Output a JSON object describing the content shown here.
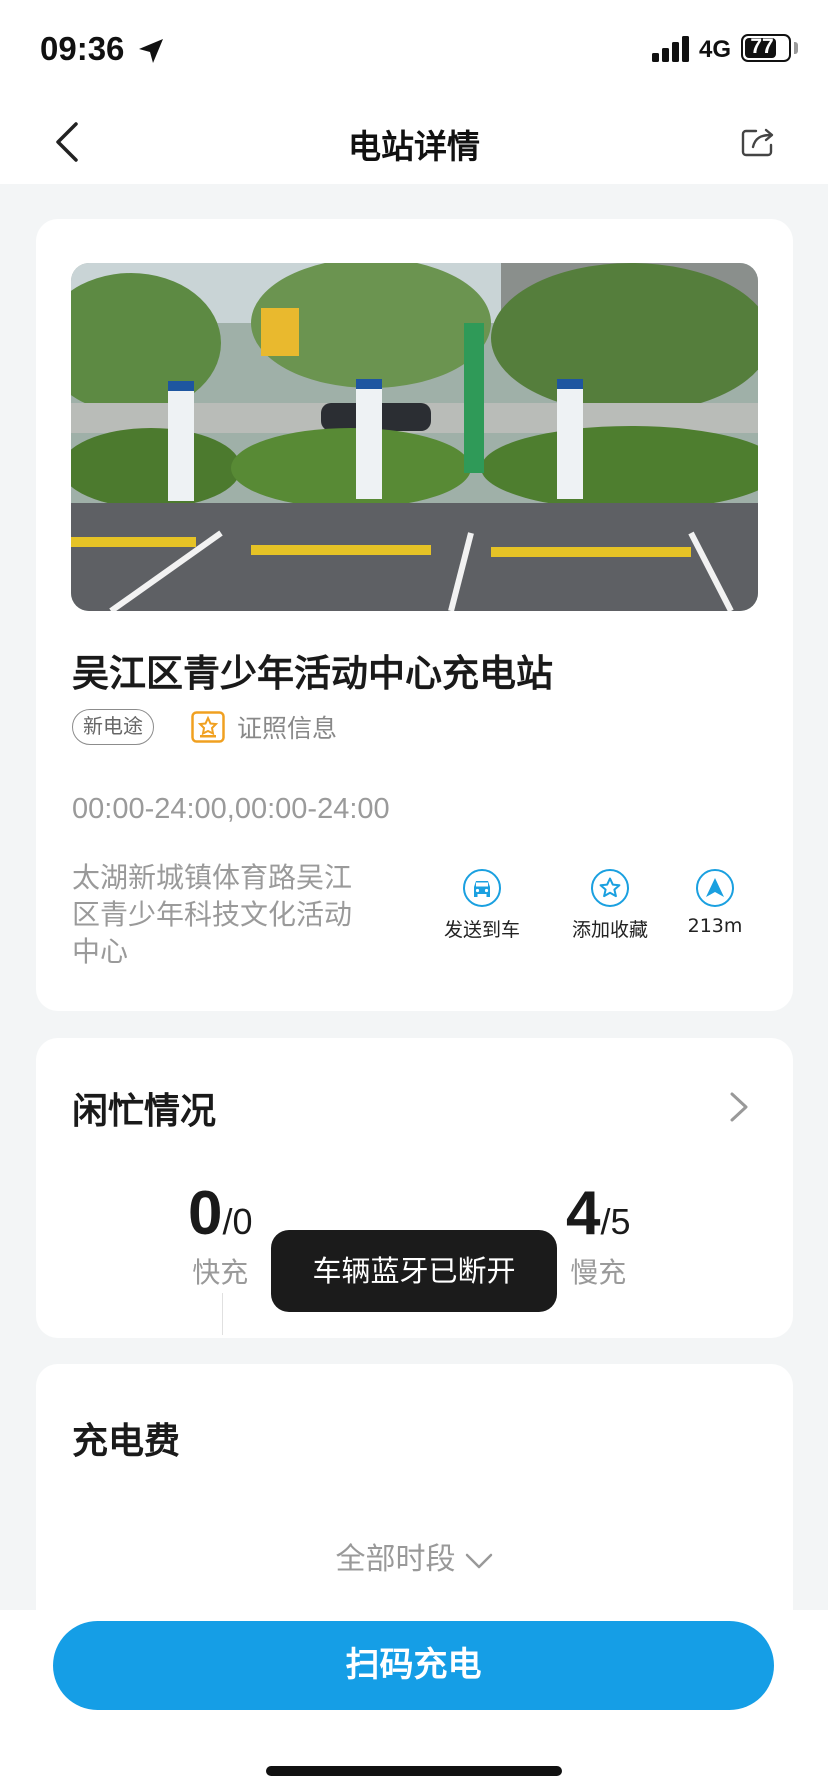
{
  "status_bar": {
    "time": "09:36",
    "network": "4G",
    "battery": "77",
    "battery_level_percent": 77
  },
  "nav": {
    "title": "电站详情",
    "back_icon": "chevron-left-icon",
    "share_icon": "share-icon"
  },
  "station": {
    "name": "吴江区青少年活动中心充电站",
    "operator_tag": "新电途",
    "license_label": "证照信息",
    "hours": "00:00-24:00,00:00-24:00",
    "address": "太湖新城镇体育路吴江区青少年科技文化活动中心",
    "actions": {
      "send_to_car": "发送到车",
      "add_favorite": "添加收藏",
      "distance": "213m"
    }
  },
  "availability": {
    "title": "闲忙情况",
    "fast": {
      "available": "0",
      "total": "/0",
      "label": "快充"
    },
    "slow": {
      "available": "4",
      "total": "/5",
      "label": "慢充"
    }
  },
  "toast": "车辆蓝牙已断开",
  "fees": {
    "title": "充电费",
    "period_select": "全部时段"
  },
  "bottom": {
    "scan_button": "扫码充电"
  },
  "colors": {
    "accent": "#159ee6",
    "license_icon": "#f0a020",
    "page_bg": "#f3f5f6"
  }
}
